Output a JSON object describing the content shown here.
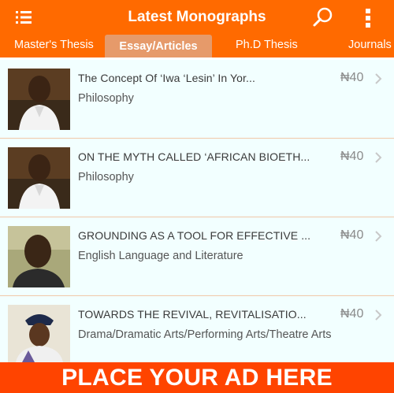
{
  "header": {
    "title": "Latest Monographs",
    "menu_icon": "list-menu-icon",
    "search_icon": "search-icon",
    "more_icon": "more-vertical-icon",
    "bar_color": "#ff6a00"
  },
  "tabs": [
    {
      "label": "Master's Thesis",
      "active": false
    },
    {
      "label": "Essay/Articles",
      "active": true
    },
    {
      "label": "Ph.D Thesis",
      "active": false
    },
    {
      "label": "Journals",
      "active": false
    }
  ],
  "items": [
    {
      "title": "The Concept Of ‘Iwa ‘Lesin’ In Yor...",
      "category": "Philosophy",
      "price": "₦40",
      "thumbnail": "author-portrait"
    },
    {
      "title": "ON THE MYTH CALLED ‘AFRICAN BIOETH...",
      "category": "Philosophy",
      "price": "₦40",
      "thumbnail": "author-portrait"
    },
    {
      "title": "GROUNDING AS A TOOL FOR EFFECTIVE ...",
      "category": "English Language and Literature",
      "price": "₦40",
      "thumbnail": "author-portrait"
    },
    {
      "title": "TOWARDS THE REVIVAL, REVITALISATIO...",
      "category": "Drama/Dramatic Arts/Performing Arts/Theatre Arts",
      "price": "₦40",
      "thumbnail": "author-portrait"
    }
  ],
  "ad_banner": {
    "text": "PLACE YOUR AD HERE",
    "color": "#ff4400"
  }
}
